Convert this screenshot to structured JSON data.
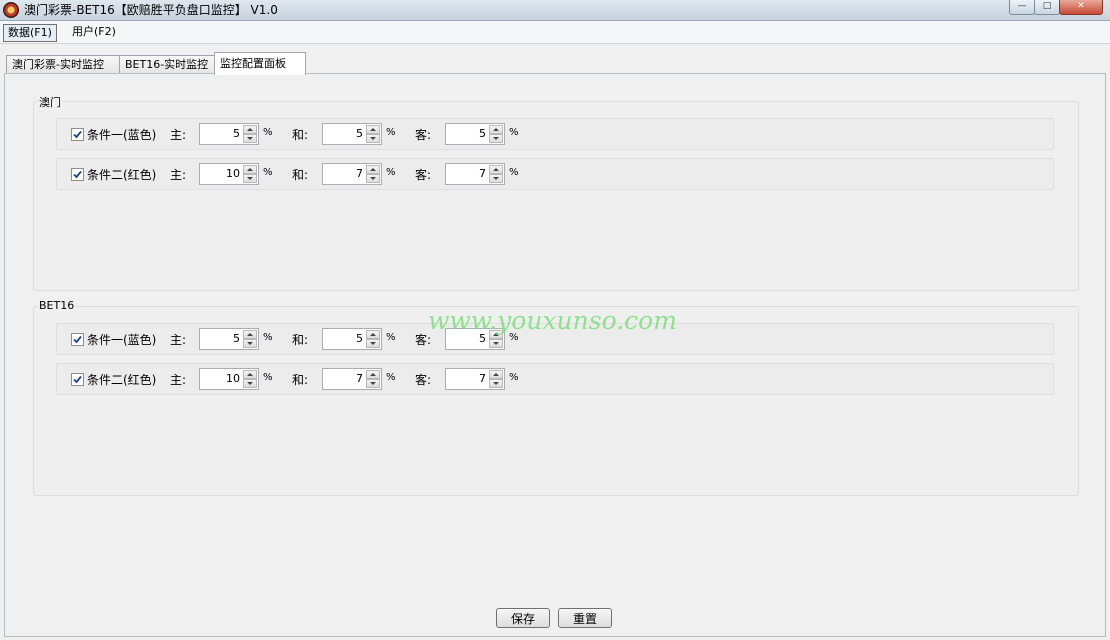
{
  "window": {
    "title": "澳门彩票-BET16【欧赔胜平负盘口监控】 V1.0",
    "min_glyph": "—",
    "max_glyph": "□",
    "close_glyph": "✕"
  },
  "menu": {
    "data": "数据(F1)",
    "user": "用户(F2)"
  },
  "tabs": [
    {
      "label": "澳门彩票-实时监控",
      "active": false
    },
    {
      "label": "BET16-实时监控",
      "active": false
    },
    {
      "label": "监控配置面板",
      "active": true
    }
  ],
  "field_labels": {
    "home": "主:",
    "draw": "和:",
    "away": "客:",
    "percent": "%"
  },
  "groups": [
    {
      "label": "澳门",
      "rows": [
        {
          "condition": "条件一(蓝色)",
          "checked": true,
          "home": "5",
          "draw": "5",
          "away": "5"
        },
        {
          "condition": "条件二(红色)",
          "checked": true,
          "home": "10",
          "draw": "7",
          "away": "7"
        }
      ]
    },
    {
      "label": "BET16",
      "rows": [
        {
          "condition": "条件一(蓝色)",
          "checked": true,
          "home": "5",
          "draw": "5",
          "away": "5"
        },
        {
          "condition": "条件二(红色)",
          "checked": true,
          "home": "10",
          "draw": "7",
          "away": "7"
        }
      ]
    }
  ],
  "watermark": "www.youxunso.com",
  "buttons": {
    "save": "保存",
    "reset": "重置"
  },
  "colors": {
    "watermark": "#7de07d",
    "check": "#1e3f8c"
  }
}
